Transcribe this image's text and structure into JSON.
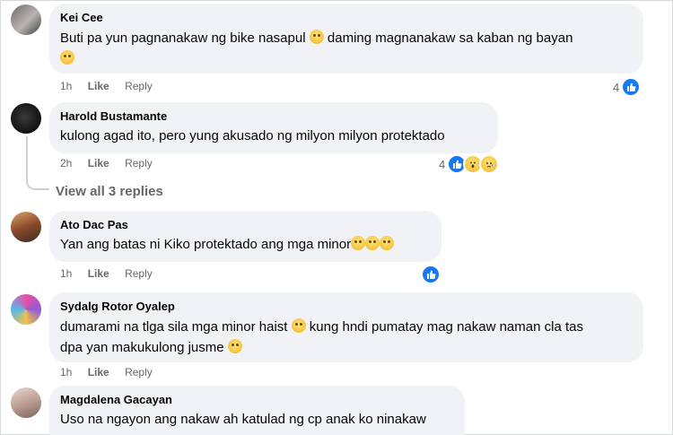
{
  "comments": [
    {
      "author": "Kei Cee",
      "text": "Buti pa yun pagnanakaw ng bike nasapul",
      "text_b": "daming magnanakaw sa kaban ng bayan",
      "time": "1h",
      "like_label": "Like",
      "reply_label": "Reply",
      "reaction_count": "4",
      "reactions": [
        "like"
      ]
    },
    {
      "author": "Harold Bustamante",
      "text": "kulong agad ito, pero yung akusado ng milyon milyon protektado",
      "time": "2h",
      "like_label": "Like",
      "reply_label": "Reply",
      "reaction_count": "4",
      "reactions": [
        "like",
        "wow",
        "sad"
      ]
    },
    {
      "author": "Ato Dac Pas",
      "text": "Yan ang batas ni Kiko protektado ang mga minor",
      "time": "1h",
      "like_label": "Like",
      "reply_label": "Reply",
      "reactions": [
        "like"
      ]
    },
    {
      "author": "Sydalg Rotor Oyalep",
      "text": "dumarami na tlga sila mga minor haist",
      "text_b": "kung hndi pumatay mag nakaw naman cla tas",
      "text_c": "dpa yan makukulong jusme",
      "time": "1h",
      "like_label": "Like",
      "reply_label": "Reply"
    },
    {
      "author": "Magdalena Gacayan",
      "text": "Uso na ngayon ang nakaw ah katulad ng cp anak ko ninakaw"
    }
  ],
  "view_replies_label": "View all 3 replies",
  "colors": {
    "bubble": "#f0f2f5",
    "meta": "#65676b",
    "like_blue": "#1877f2"
  }
}
